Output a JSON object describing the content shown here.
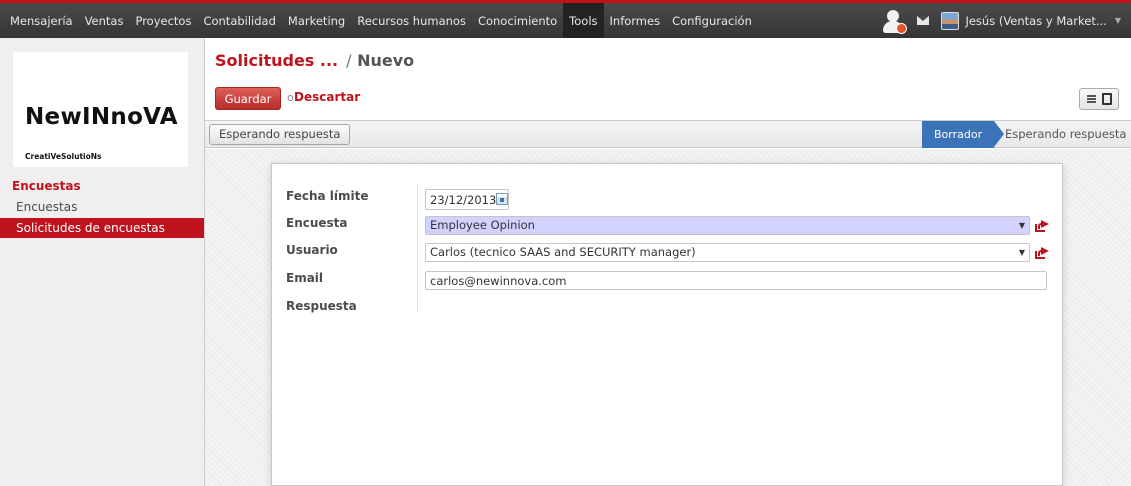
{
  "topbar": {
    "menu": [
      "Mensajería",
      "Ventas",
      "Proyectos",
      "Contabilidad",
      "Marketing",
      "Recursos humanos",
      "Conocimiento",
      "Tools",
      "Informes",
      "Configuración"
    ],
    "active_menu": "Tools",
    "user_name": "Jesús (Ventas y Market...",
    "accent_color": "#c0121c"
  },
  "sidebar": {
    "logo_title": "NewINnoVA",
    "logo_subtitle": "CreatiVeSolutioNs",
    "section_title": "Encuestas",
    "items": [
      {
        "label": "Encuestas",
        "active": false
      },
      {
        "label": "Solicitudes de encuestas",
        "active": true
      }
    ]
  },
  "header": {
    "breadcrumb_parent": "Solicitudes ...",
    "breadcrumb_separator": "/",
    "breadcrumb_current": "Nuevo"
  },
  "toolbar": {
    "save_label": "Guardar",
    "or_label": "o",
    "discard_label": "Descartar"
  },
  "statusbar": {
    "action_button": "Esperando respuesta",
    "stages": [
      "Borrador",
      "Esperando respuesta"
    ],
    "current_stage": "Borrador",
    "current_stage_color": "#3a73b8"
  },
  "form": {
    "fields": {
      "deadline": {
        "label": "Fecha límite",
        "value": "23/12/2013"
      },
      "survey": {
        "label": "Encuesta",
        "value": "Employee Opinion"
      },
      "user": {
        "label": "Usuario",
        "value": "Carlos (tecnico SAAS and SECURITY manager)"
      },
      "email": {
        "label": "Email",
        "value": "carlos@newinnova.com"
      },
      "response": {
        "label": "Respuesta",
        "value": ""
      }
    }
  }
}
